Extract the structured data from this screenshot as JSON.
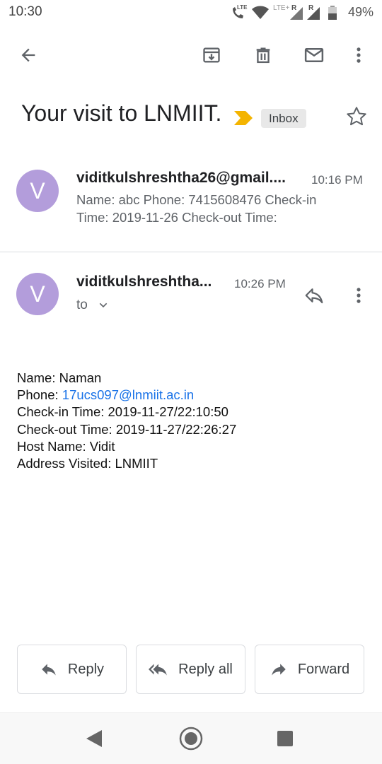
{
  "status_bar": {
    "time": "10:30",
    "network_1": "LTE",
    "network_2": "LTE+",
    "roaming_1": "R",
    "roaming_2": "R",
    "battery": "49%"
  },
  "toolbar": {
    "back_icon": "arrow-back-icon",
    "archive_icon": "archive-icon",
    "delete_icon": "trash-icon",
    "mark_unread_icon": "mail-icon",
    "more_icon": "more-vert-icon"
  },
  "subject": {
    "title": "Your visit to LNMIIT.",
    "label": "Inbox",
    "importance_color": "#f4b400"
  },
  "messages": [
    {
      "avatar_letter": "V",
      "sender": "viditkulshreshtha26@gmail....",
      "time": "10:16 PM",
      "snippet_line1": "Name: abc Phone: 7415608476 Check-in",
      "snippet_line2": "Time: 2019-11-26 Check-out Time:"
    },
    {
      "avatar_letter": "V",
      "sender": "viditkulshreshtha...",
      "time": "10:26 PM",
      "recipient_label": "to"
    }
  ],
  "body": {
    "name_line": "Name: Naman",
    "phone_label": "Phone: ",
    "phone_link": "17ucs097@lnmiit.ac.in",
    "checkin_line": "Check-in Time: 2019-11-27/22:10:50",
    "checkout_line": "Check-out Time: 2019-11-27/22:26:27",
    "host_line": "Host Name: Vidit",
    "address_line": "Address Visited: LNMIIT"
  },
  "actions": {
    "reply": "Reply",
    "reply_all": "Reply all",
    "forward": "Forward"
  },
  "colors": {
    "avatar": "#b39ddb",
    "link": "#1a73e8"
  }
}
